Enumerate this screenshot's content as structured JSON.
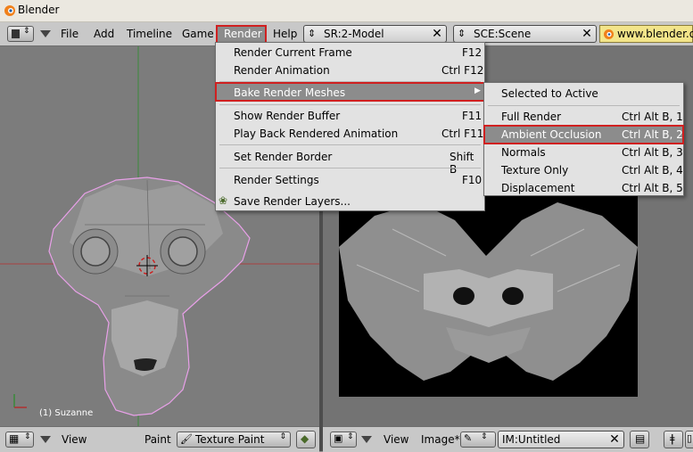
{
  "window": {
    "title": "Blender"
  },
  "header": {
    "menus": [
      "File",
      "Add",
      "Timeline",
      "Game",
      "Render",
      "Help"
    ],
    "screen_field": "SR:2-Model",
    "scene_field": "SCE:Scene",
    "url": "www.blender.or"
  },
  "render_menu": {
    "items": [
      {
        "label": "Render Current Frame",
        "shortcut": "F12"
      },
      {
        "label": "Render Animation",
        "shortcut": "Ctrl F12"
      },
      {
        "label": "Bake Render Meshes",
        "shortcut": ""
      },
      {
        "label": "Show Render Buffer",
        "shortcut": "F11"
      },
      {
        "label": "Play Back Rendered Animation",
        "shortcut": "Ctrl F11"
      },
      {
        "label": "Set Render Border",
        "shortcut": "Shift B"
      },
      {
        "label": "Render Settings",
        "shortcut": "F10"
      },
      {
        "label": "Save Render Layers...",
        "shortcut": ""
      }
    ]
  },
  "bake_submenu": {
    "items": [
      {
        "label": "Selected to Active",
        "shortcut": ""
      },
      {
        "label": "Full Render",
        "shortcut": "Ctrl Alt B, 1"
      },
      {
        "label": "Ambient Occlusion",
        "shortcut": "Ctrl Alt B, 2"
      },
      {
        "label": "Normals",
        "shortcut": "Ctrl Alt B, 3"
      },
      {
        "label": "Texture Only",
        "shortcut": "Ctrl Alt B, 4"
      },
      {
        "label": "Displacement",
        "shortcut": "Ctrl Alt B, 5"
      }
    ]
  },
  "viewport3d": {
    "object_label": "(1) Suzanne"
  },
  "bottom_left": {
    "view": "View",
    "mode_label": "Paint",
    "mode_value": "Texture Paint"
  },
  "bottom_right": {
    "view": "View",
    "image": "Image*",
    "image_field": "IM:Untitled"
  },
  "colors": {
    "highlight": "#8c8c8c",
    "redbox": "#d02020",
    "menu_bg": "#e2e2e2"
  }
}
